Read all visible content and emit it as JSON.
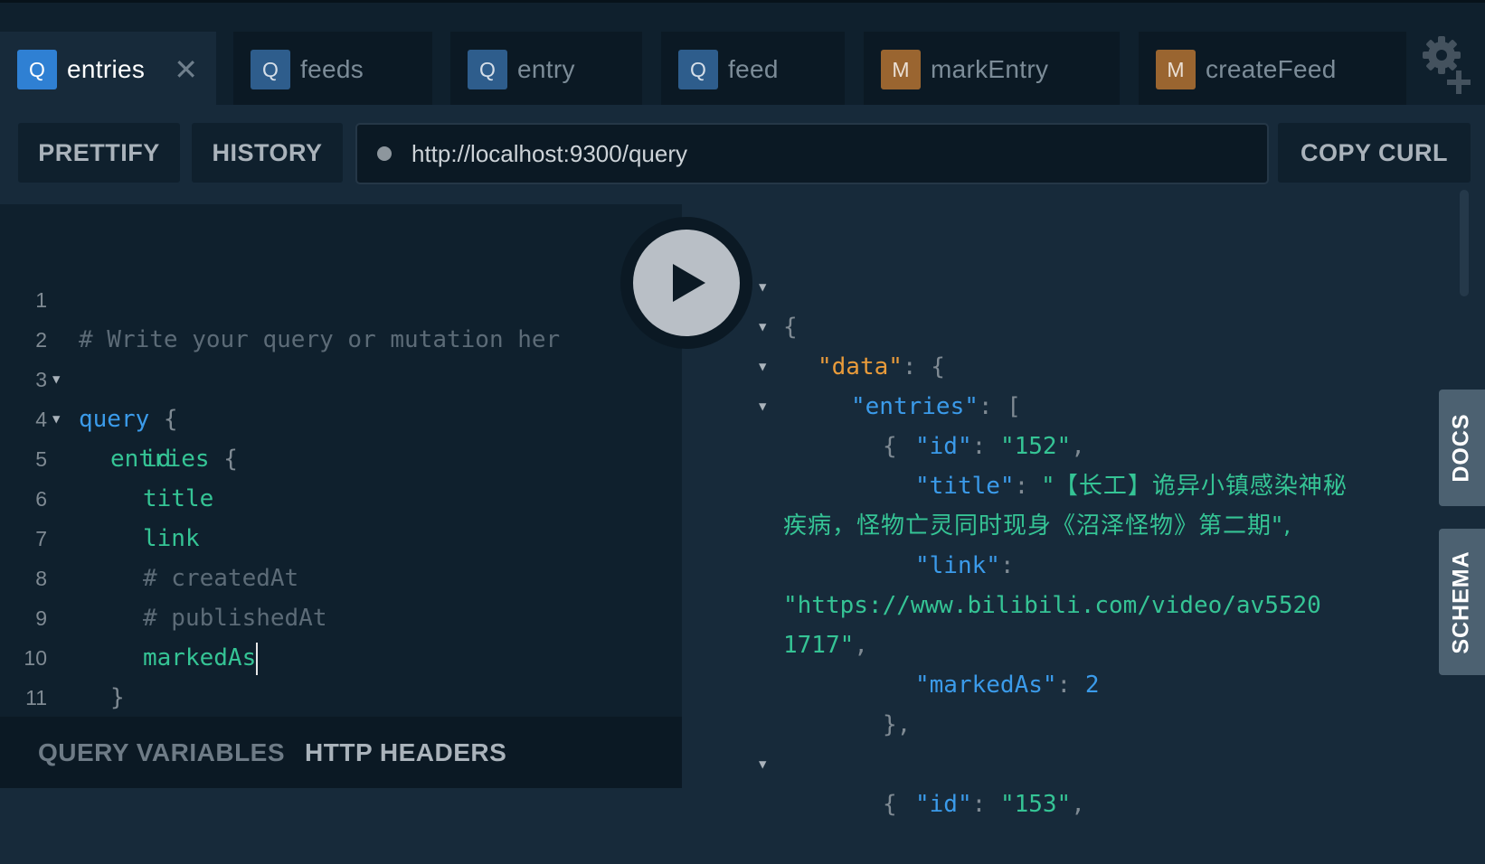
{
  "tabs": [
    {
      "badge": "Q",
      "label": "entries",
      "close": "✕"
    },
    {
      "badge": "Q",
      "label": "feeds"
    },
    {
      "badge": "Q",
      "label": "entry"
    },
    {
      "badge": "Q",
      "label": "feed"
    },
    {
      "badge": "M",
      "label": "markEntry"
    },
    {
      "badge": "M",
      "label": "createFeed"
    }
  ],
  "toolbar": {
    "prettify": "PRETTIFY",
    "history": "HISTORY",
    "url": "http://localhost:9300/query",
    "copy_curl": "COPY CURL"
  },
  "editor": {
    "line_numbers": [
      "1",
      "2",
      "3",
      "4",
      "5",
      "6",
      "7",
      "8",
      "9",
      "10",
      "11"
    ],
    "l1_comment": "# Write your query or mutation her",
    "l2_kw": "query",
    "l2_brace": " {",
    "l3_field": "entries",
    "l3_brace": " {",
    "l4_field": "id",
    "l5_field": "title",
    "l6_field": "link",
    "l7_comment": "# createdAt",
    "l8_comment": "# publishedAt",
    "l9_field": "markedAs",
    "l10_brace": "}",
    "l11_brace": "}"
  },
  "bottom": {
    "query_variables": "QUERY VARIABLES",
    "http_headers": "HTTP HEADERS"
  },
  "result": {
    "r1": "{",
    "data_key": "\"data\"",
    "colon_brace": ": {",
    "entries_key": "\"entries\"",
    "colon_bracket": ": [",
    "obj_open": "{",
    "id_key": "\"id\"",
    "colon": ": ",
    "id_val": "\"152\"",
    "comma": ",",
    "title_key": "\"title\"",
    "title_val_1": "\"【长工】诡异小镇感染神秘",
    "title_val_2": "疾病，怪物亡灵同时现身《沼泽怪物》第二期\",",
    "link_key": "\"link\"",
    "colon_only": ":",
    "link_val_1": "\"https://www.bilibili.com/video/av5520",
    "link_val_2": "1717\"",
    "marked_key": "\"markedAs\"",
    "marked_val": "2",
    "obj_close": "},",
    "obj_open_2": "{",
    "id_val_2": "\"153\""
  },
  "side": {
    "docs": "DOCS",
    "schema": "SCHEMA"
  },
  "icons": {
    "settings": "gear-plus-icon",
    "play": "play-icon"
  }
}
